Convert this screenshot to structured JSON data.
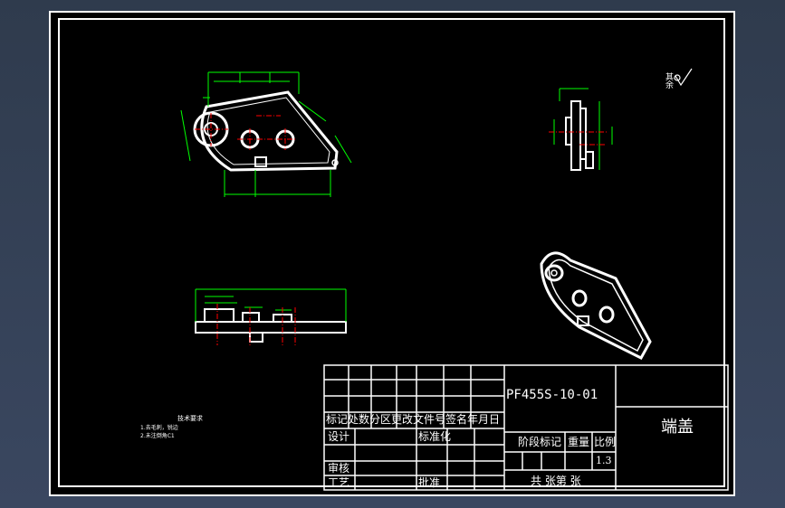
{
  "drawing": {
    "code": "PF455S-10-01",
    "part_name": "端盖",
    "scale": "1.3",
    "surface_finish": "其余",
    "technical_requirements": {
      "title": "技术要求",
      "items": [
        "1.去毛刺，锐边",
        "2.未注倒角C1"
      ]
    },
    "title_block": {
      "row_header": "标记处数分区更改文件号签名年月日",
      "design": "设计",
      "standardize": "标准化",
      "review": "审核",
      "process": "工艺",
      "approve": "批准",
      "stage_mark": "阶段标记",
      "weight": "重量",
      "scale_label": "比例",
      "sheets": "共  张第  张"
    },
    "colors": {
      "background": "#000000",
      "line": "#ffffff",
      "dimension": "#00ff00",
      "center": "#ff0000",
      "frame": "#3a4760"
    }
  }
}
